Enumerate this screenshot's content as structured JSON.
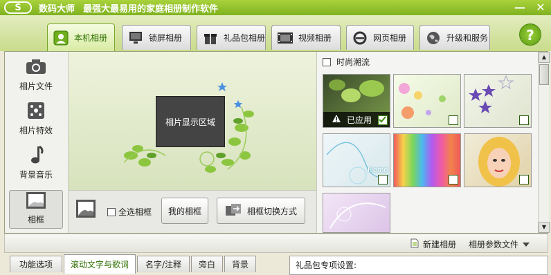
{
  "titlebar": {
    "logo_text": "S",
    "app_name": "数码大师",
    "slogan": "最强大最易用的家庭相册制作软件",
    "min_label": "—",
    "close_label": "✕"
  },
  "tabs": [
    {
      "label": "本机相册",
      "icon": "photo-icon"
    },
    {
      "label": "锁屏相册",
      "icon": "monitor-icon"
    },
    {
      "label": "礼品包相册",
      "icon": "gift-icon"
    },
    {
      "label": "视频相册",
      "icon": "film-icon"
    },
    {
      "label": "网页相册",
      "icon": "ie-icon"
    },
    {
      "label": "升级和服务",
      "icon": "globe-icon"
    }
  ],
  "help_label": "?",
  "leftnav": [
    {
      "label": "相片文件",
      "icon": "camera-icon"
    },
    {
      "label": "相片特效",
      "icon": "effects-icon"
    },
    {
      "label": "背景音乐",
      "icon": "music-note-icon"
    },
    {
      "label": "相框",
      "icon": "frame-icon"
    }
  ],
  "preview": {
    "box_label": "相片显示区域"
  },
  "previewbar": {
    "select_all": "全选相框",
    "my_frames": "我的相框",
    "switch_mode": "相框切换方式"
  },
  "gallery": {
    "category": "时尚潮流",
    "applied_label": "已应用",
    "home_text": "Home"
  },
  "statusbar": {
    "new_album": "新建相册",
    "params": "相册参数文件"
  },
  "bottomtabs": [
    "功能选项",
    "滚动文字与歌词",
    "名字/注释",
    "旁白",
    "背景"
  ],
  "giftpanel": {
    "title": "礼品包专项设置:"
  },
  "colors": {
    "accent": "#7fb21f",
    "active_text": "#2d6e00"
  }
}
